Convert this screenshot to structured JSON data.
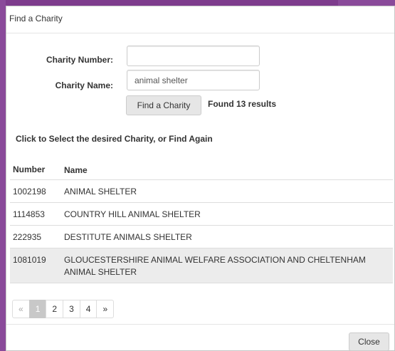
{
  "dialog": {
    "title": "Find a Charity"
  },
  "form": {
    "number_label": "Charity Number:",
    "number_value": "",
    "name_label": "Charity Name:",
    "name_value": "animal shelter",
    "find_button": "Find a Charity",
    "found_text": "Found 13 results"
  },
  "instruction": "Click to Select the desired Charity, or Find Again",
  "table": {
    "headers": [
      "Number",
      "Name"
    ],
    "rows": [
      {
        "number": "1002198",
        "name": "ANIMAL SHELTER"
      },
      {
        "number": "1114853",
        "name": "COUNTRY HILL ANIMAL SHELTER"
      },
      {
        "number": "222935",
        "name": "DESTITUTE ANIMALS SHELTER"
      },
      {
        "number": "1081019",
        "name": "GLOUCESTERSHIRE ANIMAL WELFARE ASSOCIATION AND CHELTENHAM ANIMAL SHELTER"
      }
    ]
  },
  "pagination": {
    "prev": "«",
    "pages": [
      "1",
      "2",
      "3",
      "4"
    ],
    "next": "»",
    "active_page": "1"
  },
  "footer": {
    "close_button": "Close"
  },
  "colors": {
    "background": "#7e3c8d",
    "active_page": "#c8c8c8",
    "row_hover": "#ececec"
  }
}
